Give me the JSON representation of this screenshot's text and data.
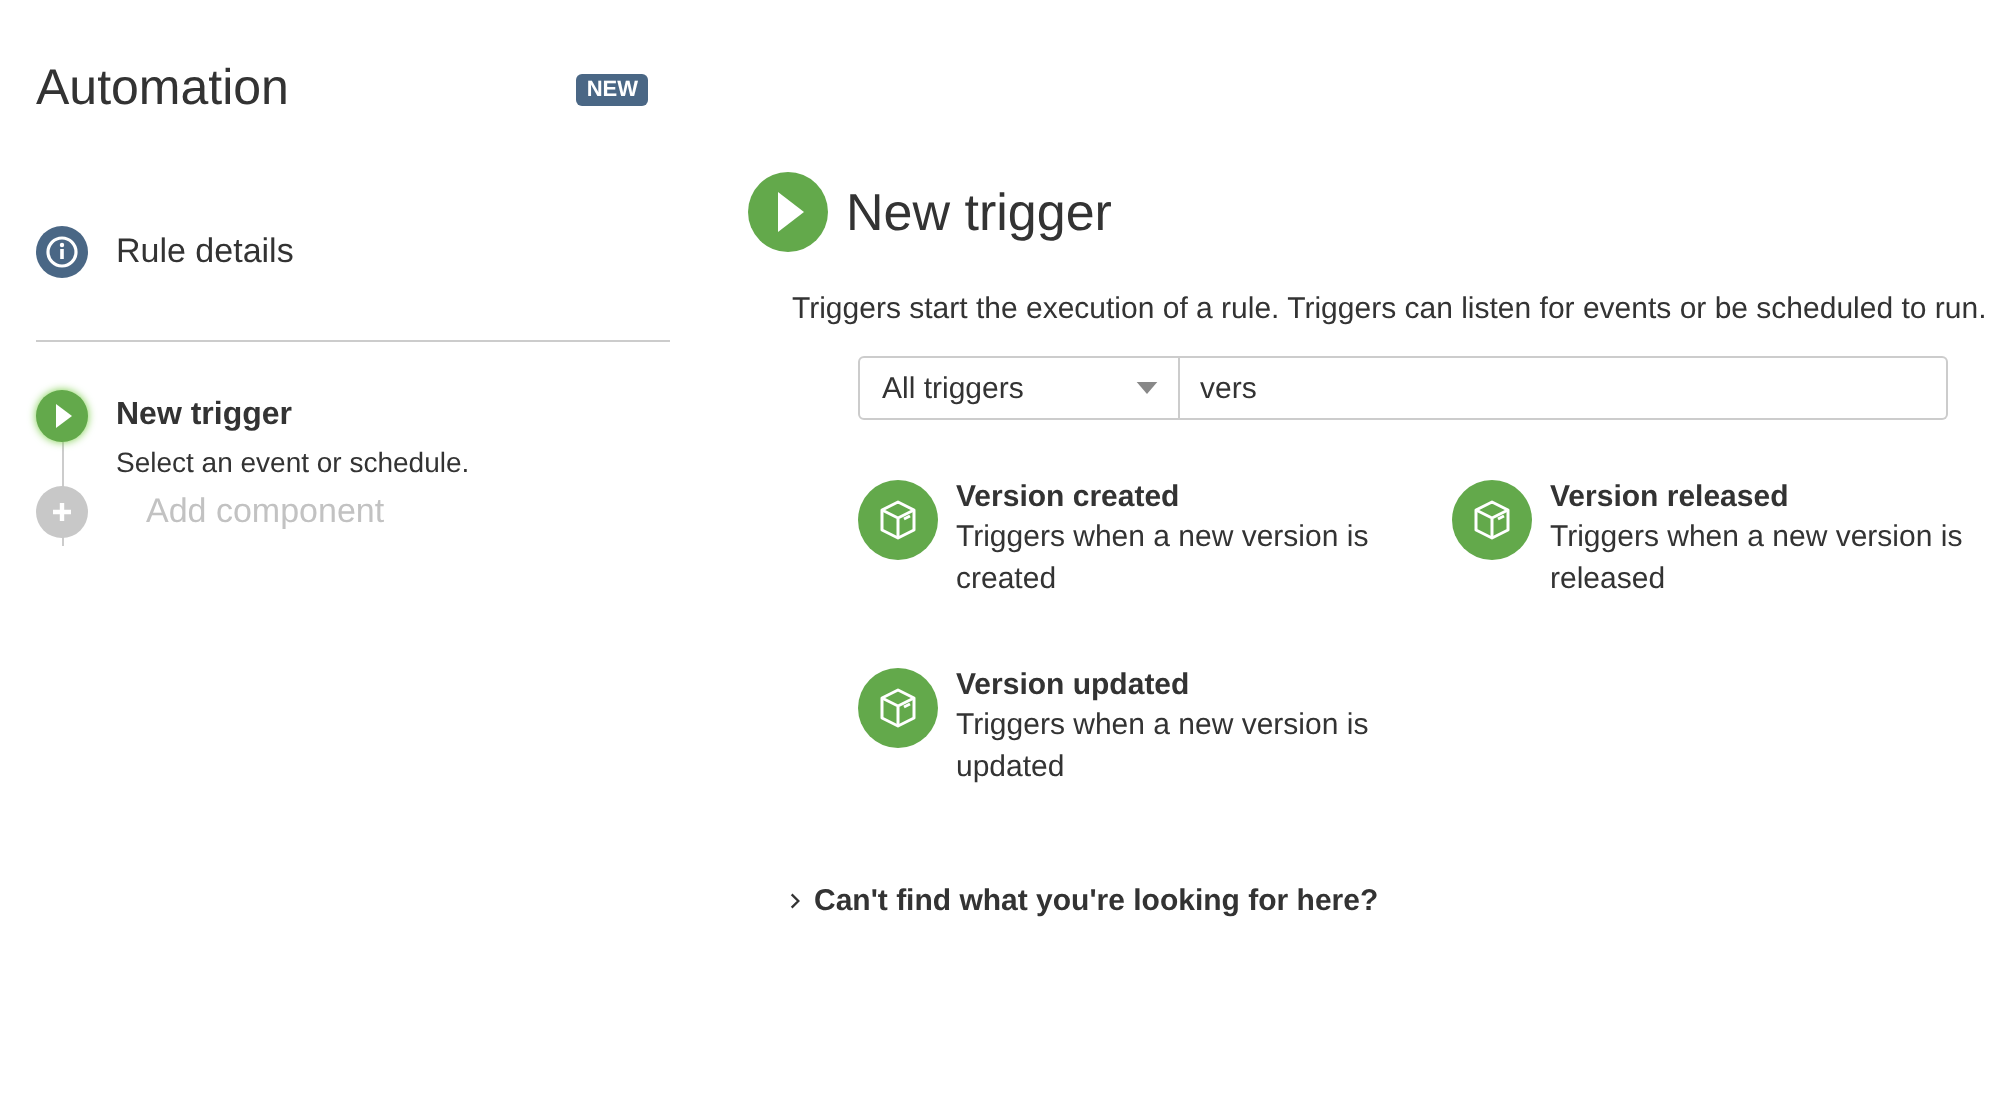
{
  "sidebar": {
    "title": "Automation",
    "badge": "NEW",
    "steps": [
      {
        "kind": "info",
        "label": "Rule details",
        "selected": false,
        "disabled": false
      },
      {
        "kind": "trigger",
        "label": "New trigger",
        "subtitle": "Select an event or schedule.",
        "selected": true,
        "disabled": false
      },
      {
        "kind": "add",
        "label": "Add component",
        "selected": false,
        "disabled": true
      }
    ]
  },
  "main": {
    "title": "New trigger",
    "description": "Triggers start the execution of a rule. Triggers can listen for events or be scheduled to run.",
    "filter": {
      "value": "All triggers"
    },
    "search": {
      "value": "vers"
    },
    "triggers": [
      {
        "title": "Version created",
        "description": "Triggers when a new version is created"
      },
      {
        "title": "Version released",
        "description": "Triggers when a new version is released"
      },
      {
        "title": "Version updated",
        "description": "Triggers when a new version is updated"
      }
    ],
    "help_link": "Can't find what you're looking for here?"
  }
}
